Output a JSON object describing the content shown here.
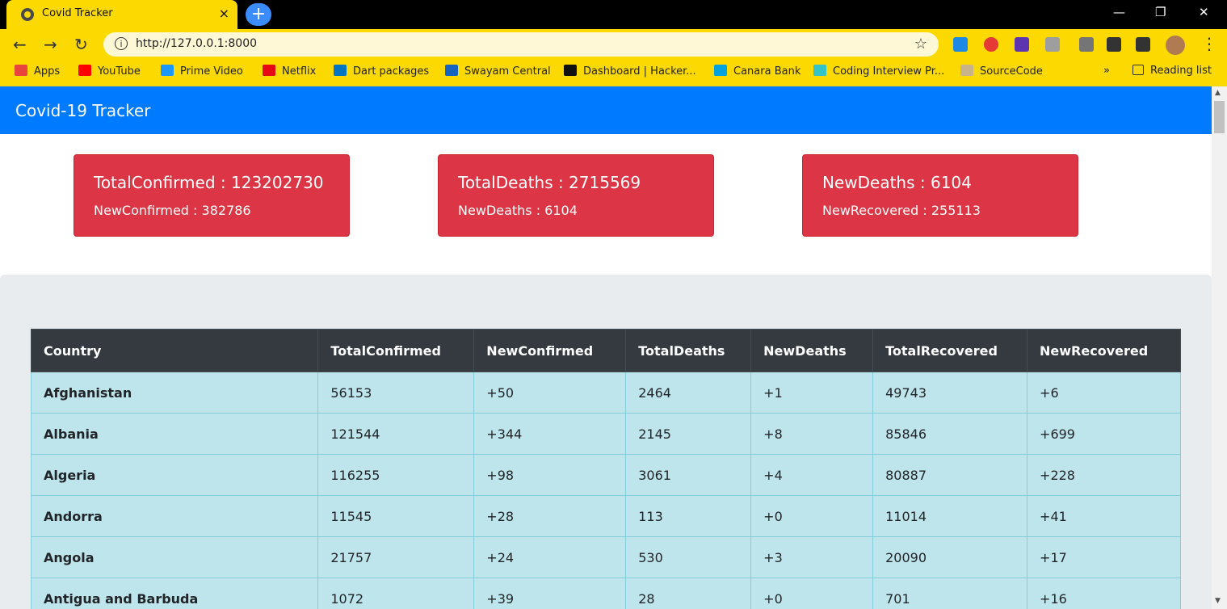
{
  "browser": {
    "tab_title": "Covid Tracker",
    "tab_close": "×",
    "new_tab": "+",
    "url": "http://127.0.0.1:8000",
    "info_icon": "i",
    "bookmark_star": "☆",
    "back": "←",
    "forward": "→",
    "reload": "↻",
    "menu": "⋮",
    "window": {
      "minimize": "—",
      "maximize": "❐",
      "close": "✕"
    },
    "bookmarks": [
      {
        "label": "Apps",
        "icon": "apps-icon",
        "color": "#e8453c"
      },
      {
        "label": "YouTube",
        "icon": "youtube-icon",
        "color": "#ff0000"
      },
      {
        "label": "Prime Video",
        "icon": "prime-video-icon",
        "color": "#1a98ff"
      },
      {
        "label": "Netflix",
        "icon": "netflix-icon",
        "color": "#e50914"
      },
      {
        "label": "Dart packages",
        "icon": "dart-icon",
        "color": "#0175c2"
      },
      {
        "label": "Swayam Central",
        "icon": "swayam-icon",
        "color": "#1565c0"
      },
      {
        "label": "Dashboard | Hacker...",
        "icon": "hackerrank-icon",
        "color": "#111111"
      },
      {
        "label": "Canara Bank",
        "icon": "canara-bank-icon",
        "color": "#00a3e0"
      },
      {
        "label": "Coding Interview Pr...",
        "icon": "coding-interview-icon",
        "color": "#34c3c9"
      },
      {
        "label": "SourceCode",
        "icon": "sourcecode-icon",
        "color": "#c9b38a"
      }
    ],
    "bookmarks_more": "»",
    "reading_list": "Reading list"
  },
  "app": {
    "brand": "Covid-19 Tracker",
    "cards": [
      {
        "title": "TotalConfirmed : 123202730",
        "text": "NewConfirmed : 382786"
      },
      {
        "title": "TotalDeaths : 2715569",
        "text": "NewDeaths : 6104"
      },
      {
        "title": "NewDeaths : 6104",
        "text": "NewRecovered : 255113"
      }
    ],
    "table": {
      "headers": [
        "Country",
        "TotalConfirmed",
        "NewConfirmed",
        "TotalDeaths",
        "NewDeaths",
        "TotalRecovered",
        "NewRecovered"
      ],
      "rows": [
        [
          "Afghanistan",
          "56153",
          "+50",
          "2464",
          "+1",
          "49743",
          "+6"
        ],
        [
          "Albania",
          "121544",
          "+344",
          "2145",
          "+8",
          "85846",
          "+699"
        ],
        [
          "Algeria",
          "116255",
          "+98",
          "3061",
          "+4",
          "80887",
          "+228"
        ],
        [
          "Andorra",
          "11545",
          "+28",
          "113",
          "+0",
          "11014",
          "+41"
        ],
        [
          "Angola",
          "21757",
          "+24",
          "530",
          "+3",
          "20090",
          "+17"
        ],
        [
          "Antigua and Barbuda",
          "1072",
          "+39",
          "28",
          "+0",
          "701",
          "+16"
        ]
      ]
    }
  },
  "colors": {
    "navbar": "#007bff",
    "card": "#dc3545",
    "table_header": "#343a40",
    "table_row": "#bee5eb",
    "chrome": "#fcd900"
  }
}
